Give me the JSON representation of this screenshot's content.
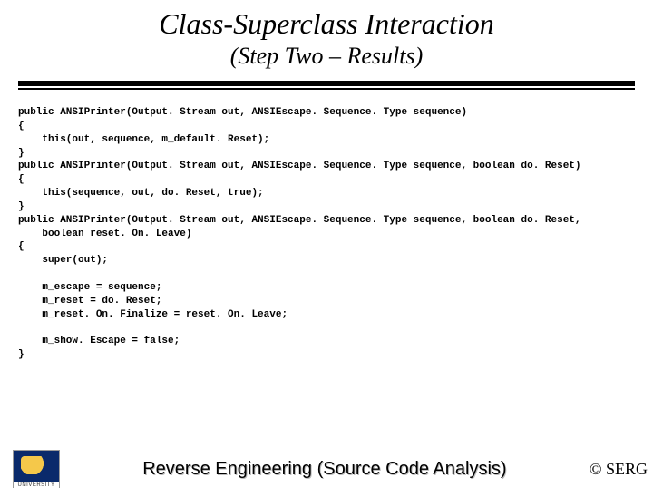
{
  "title": "Class-Superclass Interaction",
  "subtitle": "(Step Two – Results)",
  "code": "public ANSIPrinter(Output. Stream out, ANSIEscape. Sequence. Type sequence)\n{\n    this(out, sequence, m_default. Reset);\n}\npublic ANSIPrinter(Output. Stream out, ANSIEscape. Sequence. Type sequence, boolean do. Reset)\n{\n    this(sequence, out, do. Reset, true);\n}\npublic ANSIPrinter(Output. Stream out, ANSIEscape. Sequence. Type sequence, boolean do. Reset,\n    boolean reset. On. Leave)\n{\n    super(out);\n\n    m_escape = sequence;\n    m_reset = do. Reset;\n    m_reset. On. Finalize = reset. On. Leave;\n\n    m_show. Escape = false;\n}",
  "footer": {
    "logo_label": "UNIVERSITY",
    "center": "Reverse Engineering (Source Code Analysis)",
    "copyright": "© SERG"
  }
}
